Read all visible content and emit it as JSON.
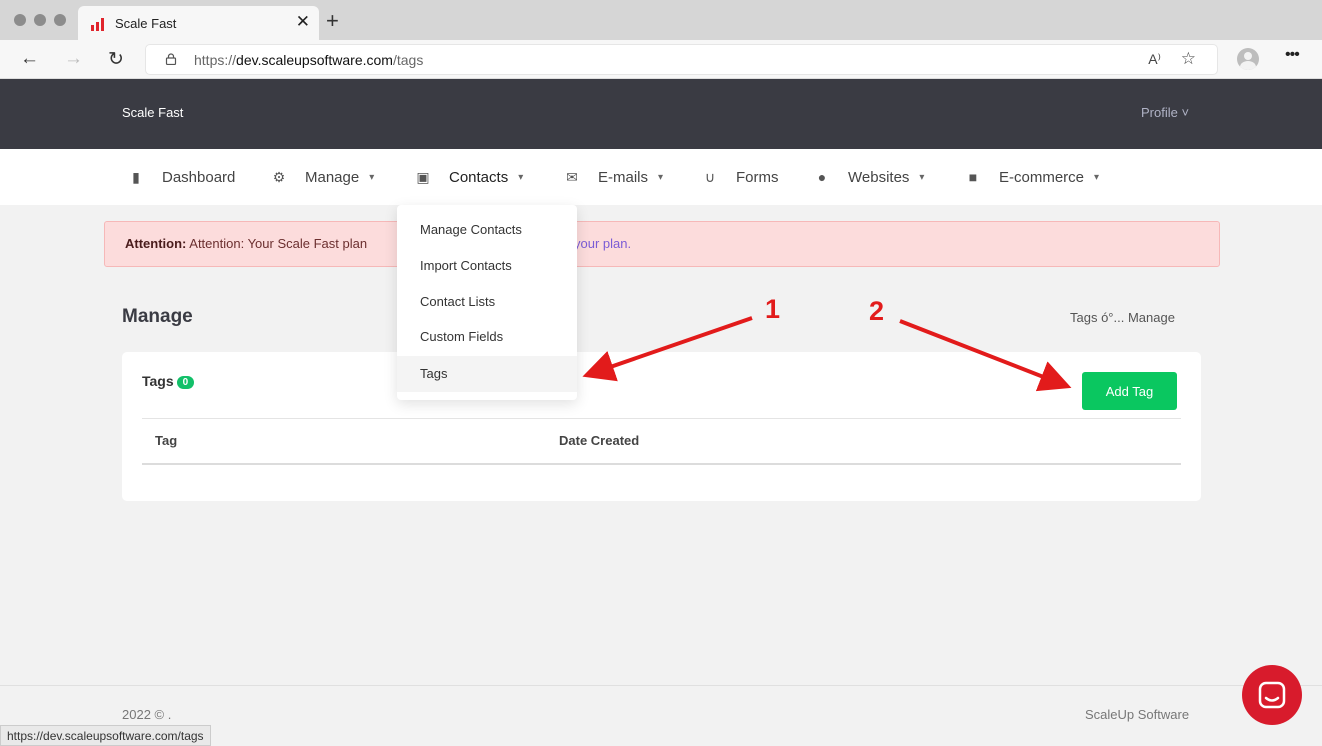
{
  "browser": {
    "tab_title": "Scale Fast",
    "url_prefix": "https://",
    "url_host": "dev.scaleupsoftware.com",
    "url_path": "/tags",
    "status_url": "https://dev.scaleupsoftware.com/tags"
  },
  "header": {
    "brand": "Scale Fast",
    "profile": "Profile ˅"
  },
  "nav": {
    "dashboard": "Dashboard",
    "manage": "Manage",
    "contacts": "Contacts",
    "emails": "E-mails",
    "forms": "Forms",
    "websites": "Websites",
    "ecommerce": "E-commerce"
  },
  "alert": {
    "strong": "Attention:",
    "text": " Attention: Your Scale Fast plan",
    "link": "your plan."
  },
  "page": {
    "title": "Manage",
    "breadcrumb": "Tags  ó°...  Manage"
  },
  "card": {
    "title": "Tags",
    "count": "0",
    "add_label": "Add Tag",
    "col_tag": "Tag",
    "col_date": "Date Created"
  },
  "dropdown": {
    "items": [
      "Manage Contacts",
      "Import Contacts",
      "Contact Lists",
      "Custom Fields",
      "Tags"
    ]
  },
  "annotations": {
    "num1": "1",
    "num2": "2",
    "color": "#e21b1b"
  },
  "footer": {
    "left": "2022 © .",
    "right": "ScaleUp Software"
  },
  "colors": {
    "header_bg": "#3a3b43",
    "accent_green": "#0ac760",
    "chat_red": "#d81b2c"
  }
}
